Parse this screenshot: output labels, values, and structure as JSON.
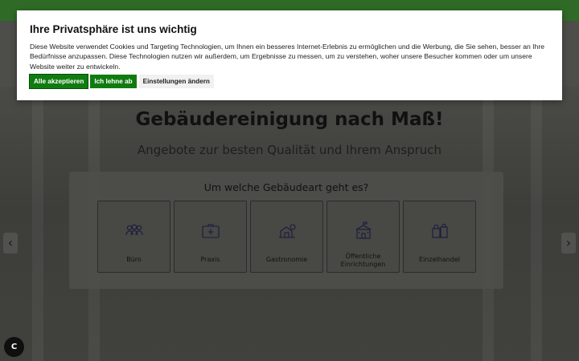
{
  "cookie": {
    "title": "Ihre Privatsphäre ist uns wichtig",
    "text": "Diese Website verwendet Cookies und Targeting Technologien, um Ihnen ein besseres Internet-Erlebnis zu ermöglichen und die Werbung, die Sie sehen, besser an Ihre Bedürfnisse anzupassen. Diese Technologien nutzen wir außerdem, um Ergebnisse zu messen, um zu verstehen, woher unsere Besucher kommen oder um unsere Website weiter zu entwickeln.",
    "accept_label": "Alle akzeptieren",
    "decline_label": "Ich lehne ab",
    "settings_label": "Einstellungen ändern"
  },
  "hero": {
    "title": "Gebäudereinigung nach Maß!",
    "subtitle": "Angebote zur besten Qualität und Ihrem Anspruch"
  },
  "selector": {
    "question": "Um welche Gebäudeart geht es?",
    "options": [
      {
        "label": "Büro",
        "icon": "people-icon"
      },
      {
        "label": "Praxis",
        "icon": "medical-kit-icon"
      },
      {
        "label": "Gastronomie",
        "icon": "restaurant-icon"
      },
      {
        "label": "Öffentliche Einrichtungen",
        "icon": "public-building-icon"
      },
      {
        "label": "Einzelhandel",
        "icon": "shopping-bags-icon"
      }
    ]
  },
  "carousel": {
    "prev_symbol": "‹",
    "next_symbol": "›"
  },
  "fab_label": "C",
  "colors": {
    "green": "#107c10",
    "topbar": "#2f6b26",
    "dialog": "#ffffff"
  }
}
